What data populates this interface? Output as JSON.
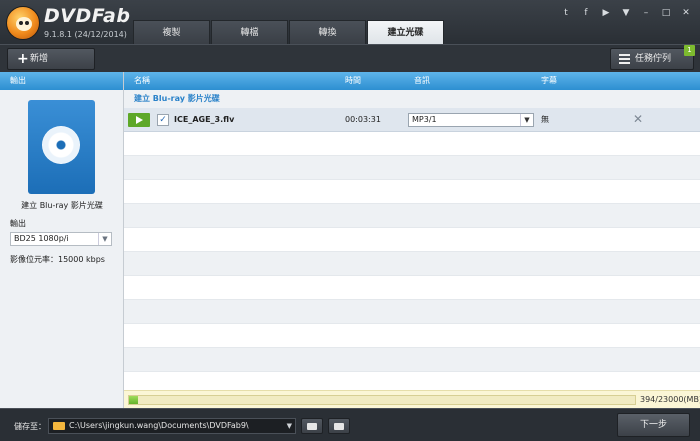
{
  "app": {
    "name": "DVDFab",
    "version": "9.1.8.1 (24/12/2014)"
  },
  "tabs": [
    {
      "label": "複製",
      "active": false
    },
    {
      "label": "轉檔",
      "active": false
    },
    {
      "label": "轉換",
      "active": false
    },
    {
      "label": "建立光碟",
      "active": true
    }
  ],
  "window_controls": [
    "twitter-icon",
    "facebook-icon",
    "youtube-icon",
    "menu-dropdown-icon",
    "minimize-icon",
    "restore-icon",
    "close-icon"
  ],
  "toolbar": {
    "add_label": "新增",
    "queue_label": "任務佇列",
    "queue_badge": "1"
  },
  "left_panel": {
    "header": "輸出",
    "disc_caption": "建立 Blu-ray 影片光碟",
    "output_label": "輸出",
    "output_value": "BD25 1080p/i",
    "bitrate_text": "影像位元率：15000 kbps"
  },
  "columns": {
    "name": "名稱",
    "time": "時間",
    "audio": "音訊",
    "subtitle": "字幕"
  },
  "group_title": "建立 Blu-ray 影片光碟",
  "files": [
    {
      "name": "ICE_AGE_3.flv",
      "duration": "00:03:31",
      "audio": "MP3/1",
      "subtitle": "無",
      "checked": true
    }
  ],
  "progress": {
    "used_fraction": 0.0171,
    "text": "394/23000(MB)"
  },
  "bottom": {
    "save_label": "儲存至：",
    "path": "C:\\Users\\jingkun.wang\\Documents\\DVDFab9\\",
    "next_label": "下一步"
  },
  "colors": {
    "accent_blue": "#2d8fd1",
    "play_green": "#5ea828",
    "progress_green": "#64b32a",
    "group_title_blue": "#2a82c9"
  }
}
